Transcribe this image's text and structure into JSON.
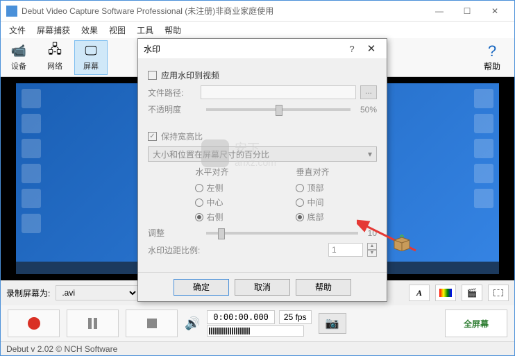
{
  "window": {
    "title": "Debut Video Capture Software Professional (未注册)非商业家庭使用",
    "min": "—",
    "max": "☐",
    "close": "✕"
  },
  "menu": {
    "file": "文件",
    "capture": "屏幕捕获",
    "effects": "效果",
    "view": "视图",
    "tools": "工具",
    "help": "帮助"
  },
  "toolbar": {
    "device": "设备",
    "network": "网络",
    "screen": "屏幕",
    "help": "帮助"
  },
  "controls": {
    "record_label": "录制屏幕为:",
    "format": ".avi",
    "time": "0:00:00.000",
    "fps": "25 fps",
    "fullscreen": "全屏幕"
  },
  "status": "Debut v 2.02 © NCH Software",
  "dialog": {
    "title": "水印",
    "apply_watermark": "应用水印到视频",
    "file_path": "文件路径:",
    "opacity": "不透明度",
    "opacity_val": "50%",
    "keep_ratio": "保持宽高比",
    "size_pos": "大小和位置在屏幕尺寸的百分比",
    "h_align": "水平对齐",
    "v_align": "垂直对齐",
    "h": {
      "left": "左侧",
      "center": "中心",
      "right": "右侧"
    },
    "v": {
      "top": "顶部",
      "middle": "中间",
      "bottom": "底部"
    },
    "adjust": "调整",
    "adjust_val": "10",
    "margin": "水印边距比例:",
    "margin_val": "1",
    "ok": "确定",
    "cancel": "取消",
    "help": "帮助"
  },
  "watermark_text": "anxz.com",
  "watermark_sub": "安下"
}
